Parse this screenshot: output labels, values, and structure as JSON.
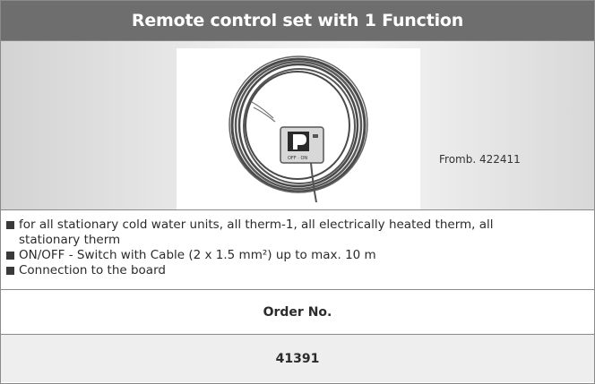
{
  "header": {
    "title": "Remote control set with 1 Function"
  },
  "product": {
    "caption": "Fromb. 422411",
    "image_alt": "remote control switch box with coiled cable"
  },
  "features": [
    "for all stationary cold water units, all therm-1, all electrically heated therm, all stationary therm",
    "ON/OFF - Switch with Cable (2 x 1.5 mm²) up to max. 10 m",
    "Connection to the board"
  ],
  "order": {
    "label": "Order No.",
    "number": "41391"
  },
  "colors": {
    "title_bar": "#6e6e6e",
    "border": "#8a8a8a",
    "order_row": "#eeeeee"
  }
}
